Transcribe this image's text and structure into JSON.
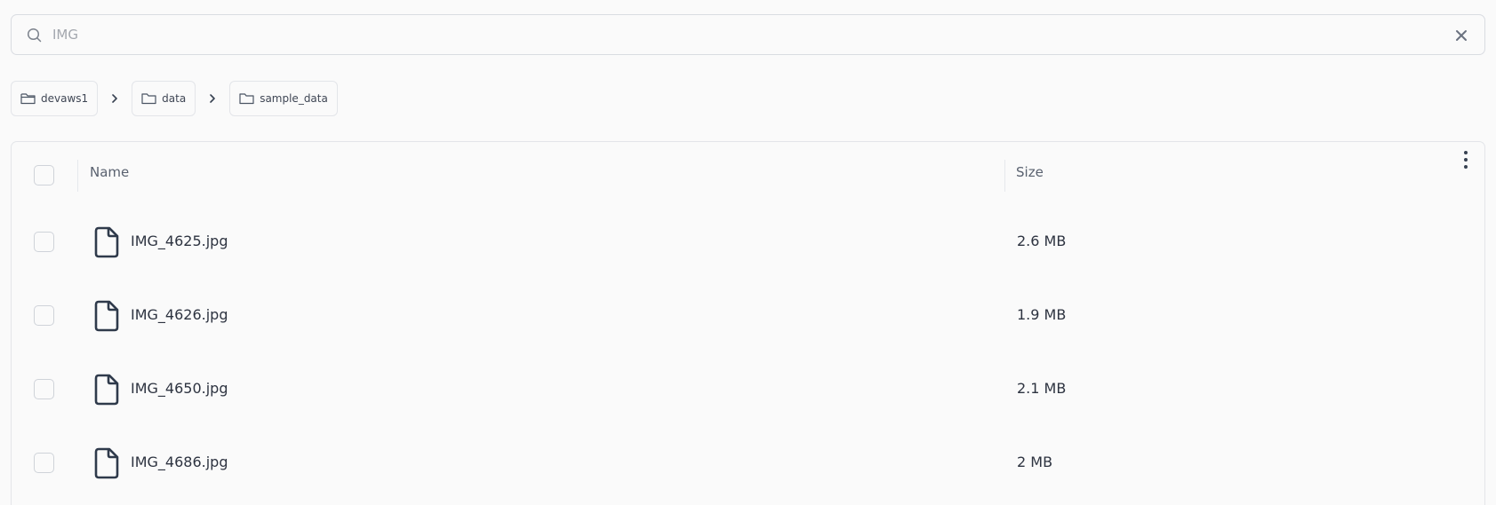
{
  "search": {
    "placeholder": "IMG",
    "value": ""
  },
  "breadcrumb": [
    {
      "label": "devaws1"
    },
    {
      "label": "data"
    },
    {
      "label": "sample_data"
    }
  ],
  "table": {
    "columns": {
      "name": "Name",
      "size": "Size"
    },
    "rows": [
      {
        "name": "IMG_4625.jpg",
        "size": "2.6 MB"
      },
      {
        "name": "IMG_4626.jpg",
        "size": "1.9 MB"
      },
      {
        "name": "IMG_4650.jpg",
        "size": "2.1 MB"
      },
      {
        "name": "IMG_4686.jpg",
        "size": "2 MB"
      }
    ]
  },
  "icons": {
    "search": "search-icon",
    "clear": "close-icon",
    "folder": "folder-icon",
    "chevron": "chevron-right-icon",
    "menu": "more-vertical-icon",
    "file": "file-icon"
  },
  "colors": {
    "background": "#fafafa",
    "border": "#e3e5e9",
    "text": "#2d3340",
    "muted": "#59616f",
    "icon": "#2f3a4b"
  }
}
